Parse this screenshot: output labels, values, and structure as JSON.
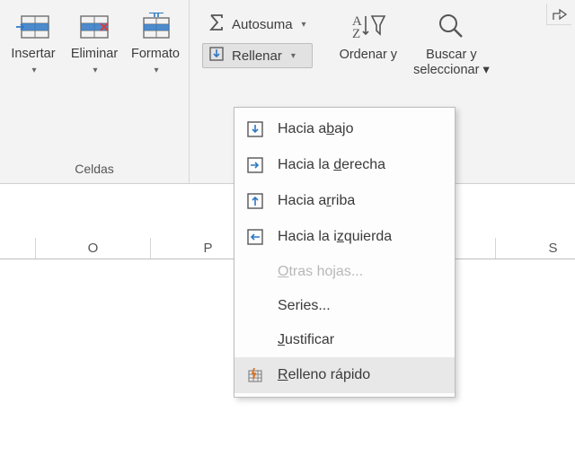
{
  "ribbon": {
    "cells_group_name": "Celdas",
    "insert_label": "Insertar",
    "delete_label": "Eliminar",
    "format_label": "Formato",
    "autosum_label": "Autosuma",
    "fill_label": "Rellenar",
    "sortfilter_line1": "Ordenar y",
    "findselect_line1": "Buscar y",
    "findselect_line2": "seleccionar"
  },
  "columns": [
    "O",
    "P",
    "",
    "",
    "S"
  ],
  "menu": {
    "down": "Hacia abajo",
    "right": "Hacia la derecha",
    "up": "Hacia arriba",
    "left": "Hacia la izquierda",
    "sheets": "Otras hojas...",
    "series": "Series...",
    "justify": "Justificar",
    "flash": "Relleno rápido"
  }
}
